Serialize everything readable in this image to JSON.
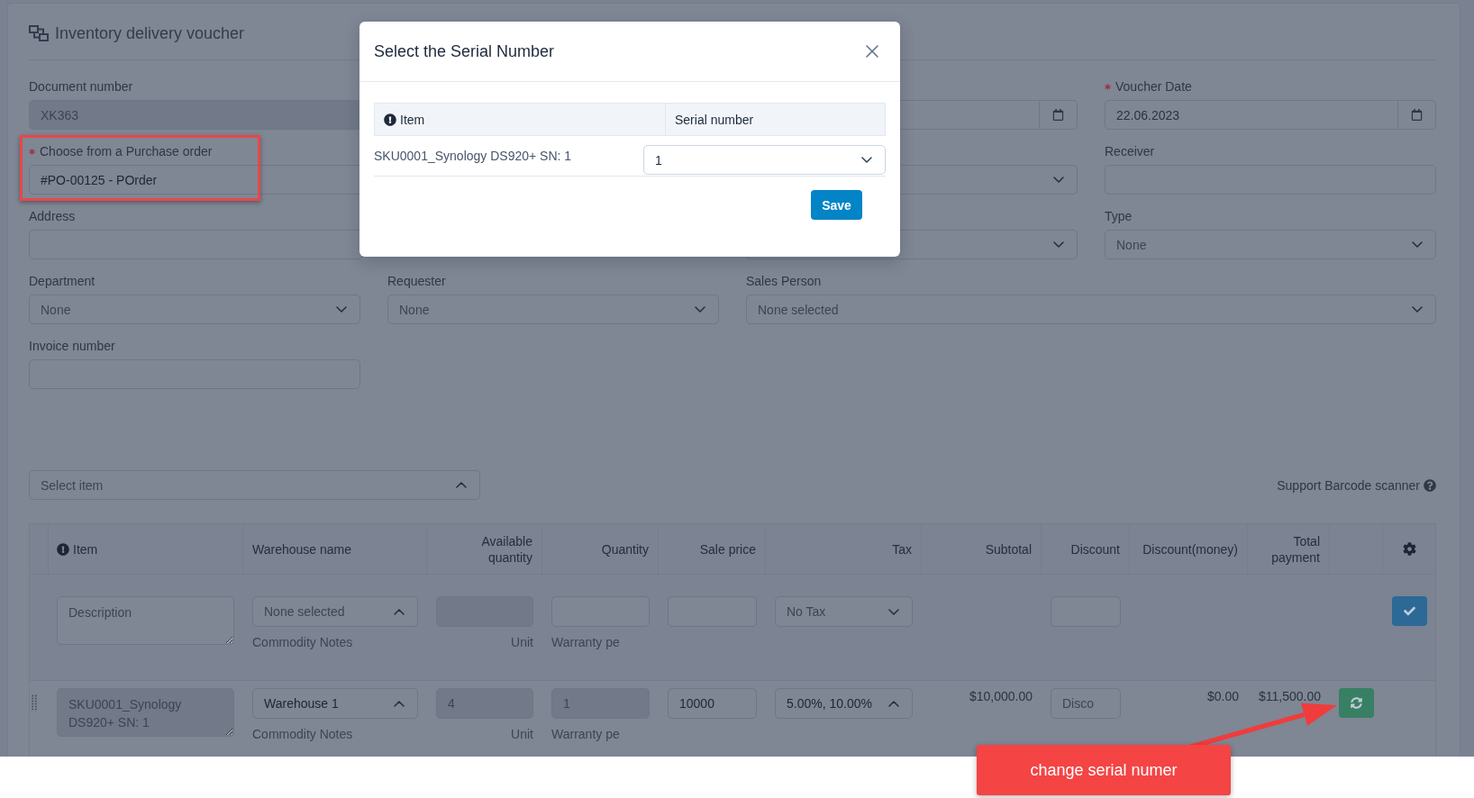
{
  "page": {
    "title": "Inventory delivery voucher"
  },
  "form": {
    "fields": [
      {
        "kind": "text",
        "label": "Document number",
        "required": false,
        "disabled": true,
        "highlighted": false,
        "value": "XK363"
      },
      {
        "kind": "date"
      },
      {
        "kind": "date",
        "label": "Voucher Date",
        "required": true,
        "disabled": false,
        "highlighted": false,
        "value": "22.06.2023"
      },
      {
        "kind": "text",
        "label": "Choose from a Purchase order",
        "required": true,
        "disabled": false,
        "highlighted": true,
        "value": "#PO-00125 - POrder"
      },
      {
        "kind": "select"
      },
      {
        "kind": "text",
        "label": "Receiver",
        "required": false,
        "disabled": false,
        "highlighted": false
      },
      {
        "kind": "text",
        "label": "Address",
        "required": false,
        "disabled": false,
        "highlighted": false
      },
      {
        "kind": "select"
      },
      {
        "kind": "select",
        "label": "Type",
        "required": false,
        "highlighted": false,
        "placeholder": "None"
      },
      {
        "kind": "select",
        "label": "Department",
        "required": false,
        "highlighted": false,
        "placeholder": "None"
      },
      {
        "kind": "select",
        "label": "Requester",
        "required": false,
        "highlighted": false,
        "placeholder": "None"
      },
      {
        "kind": "select",
        "label": "Sales Person",
        "required": false,
        "highlighted": false,
        "placeholder": "None selected"
      },
      {
        "kind": "text",
        "label": "Invoice number",
        "required": false,
        "disabled": false,
        "highlighted": false
      }
    ]
  },
  "item_picker": {
    "placeholder": "Select item",
    "expanded": true
  },
  "barcode_hint": "Support Barcode scanner",
  "table": {
    "columns": [
      "Item",
      "Warehouse name",
      "Available quantity",
      "Quantity",
      "Sale price",
      "Tax",
      "Subtotal",
      "Discount",
      "Discount(money)",
      "Total payment"
    ],
    "rows": [
      {
        "kind": "entry",
        "item": {
          "placeholder": "Description",
          "disabled": false
        },
        "warehouse": {
          "placeholder": "None selected",
          "expanded": true,
          "note": "Commodity Notes"
        },
        "available": {
          "disabled": true,
          "note": "Unit"
        },
        "quantity": {
          "disabled": false,
          "note": "Warranty pe"
        },
        "sale_price": {
          "disabled": false
        },
        "tax": {
          "placeholder": "No Tax",
          "expanded": false
        },
        "discount": {
          "disabled": false
        },
        "action": {
          "kind": "confirm"
        }
      },
      {
        "kind": "item",
        "item": {
          "value": "SKU0001_Synology DS920+ SN: 1",
          "disabled": true
        },
        "warehouse": {
          "value": "Warehouse 1",
          "expanded": true,
          "note": "Commodity Notes"
        },
        "available": {
          "value": "4",
          "disabled": true,
          "note": "Unit"
        },
        "quantity": {
          "value": "1",
          "disabled": true,
          "note": "Warranty pe"
        },
        "sale_price": {
          "value": "10000",
          "disabled": false
        },
        "tax": {
          "value": "5.00%, 10.00%",
          "expanded": true
        },
        "subtotal": "$10,000.00",
        "discount": {
          "placeholder": "Disco",
          "disabled": false
        },
        "discount_money": "$0.00",
        "total_payment": "$11,500.00",
        "action": {
          "kind": "swap"
        }
      }
    ]
  },
  "modal": {
    "title": "Select the Serial Number",
    "columns": [
      "Item",
      "Serial number"
    ],
    "rows": [
      {
        "item": "SKU0001_Synology DS920+ SN: 1",
        "serial_number": "1"
      }
    ],
    "save_button": "Save"
  },
  "callout": {
    "text": "change serial numer"
  }
}
